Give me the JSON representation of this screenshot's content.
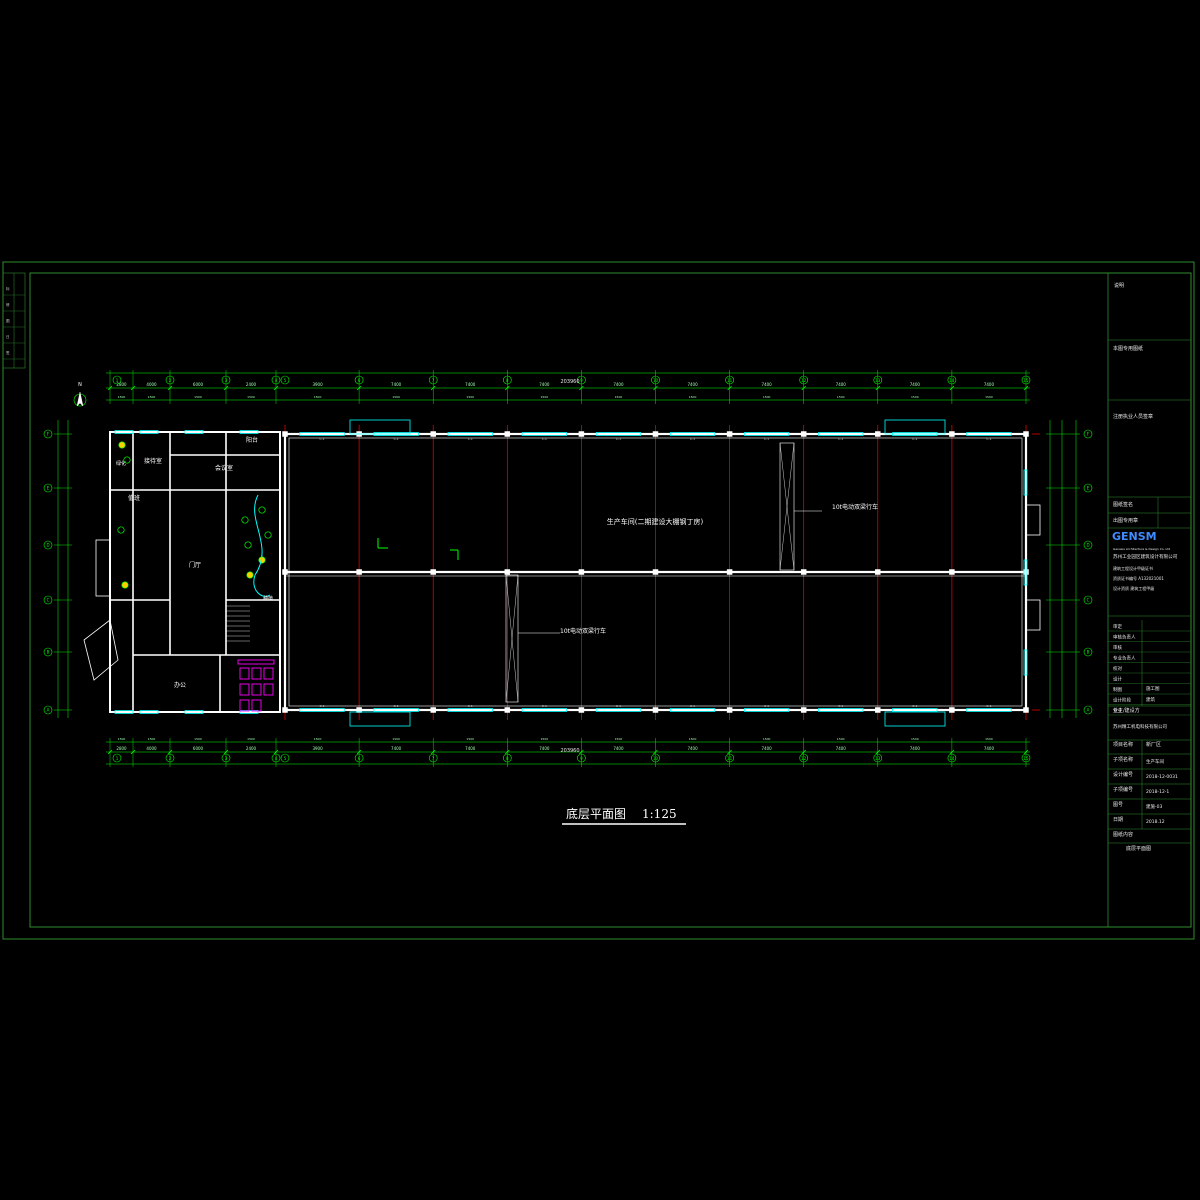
{
  "drawing": {
    "title": "底层平面图",
    "scale": "1:125",
    "colors": {
      "background": "#000000",
      "frame": "#2e8b2e",
      "dimension": "#00ff00",
      "wall": "#ffffff",
      "axis": "#ff0000",
      "window": "#00ffff",
      "label": "#ffff00",
      "sanitary": "#ff00ff",
      "planting": "#ffcc00"
    },
    "total_length": "203960",
    "rooms": {
      "workshop": "生产车间(二期建设大棚钢丁房)",
      "crane_upper": "10t电动双梁行车",
      "crane_lower": "10t电动双梁行车",
      "lobby": "门厅",
      "office": "办公",
      "meeting": "会议室",
      "reception": "接待室",
      "balcony": "阳台",
      "duty": "值班",
      "greening": "绿化",
      "planting": "种植"
    },
    "axes": {
      "top": [
        "1",
        "2",
        "3",
        "4",
        "5",
        "6",
        "7",
        "8",
        "9",
        "10",
        "11",
        "12",
        "13",
        "14",
        "15",
        "16"
      ],
      "left": [
        "A",
        "B",
        "C",
        "D",
        "E",
        "F"
      ]
    },
    "dimensions": {
      "top_bays": [
        "2800",
        "4000",
        "6000",
        "2400",
        "3900",
        "7400",
        "7400",
        "7400",
        "7400",
        "7400",
        "7400",
        "7400",
        "7400",
        "7400",
        "7000"
      ],
      "bottom_bays": [
        "2800",
        "4000",
        "6000",
        "2400",
        "3900",
        "7400",
        "7400",
        "7400",
        "7400",
        "7400",
        "7400",
        "7400",
        "7400",
        "7400",
        "7000"
      ]
    },
    "left_margin": [
      "标记",
      "修改",
      "图号",
      "日期",
      "签字"
    ]
  },
  "title_block": {
    "header": "说明",
    "notes": [
      "本图专用图纸",
      "注册执业人员签章"
    ],
    "sheet_label": "图纸签名",
    "sign_stamp": "出图专用章",
    "company_logo": "GENSM",
    "company_en": "Genesis Architecture & Design Co. Ltd",
    "company_cn": "苏州工业园区建筑设计有限公司",
    "licence_rows": [
      "建筑工程设计甲级证书",
      "资质证书编号 A132021001",
      "设计资质 建筑工程甲级"
    ],
    "roles": [
      "审定",
      "审核负责人",
      "审核",
      "专业负责人",
      "校对",
      "设计",
      "制图",
      "设计阶段",
      "专业"
    ],
    "role_values": {
      "stage": "施工图",
      "discipline": "建筑"
    },
    "client_label": "业主/建设方",
    "client_name": "苏州精工机电科技有限公司",
    "project_label": "项目名称",
    "project_name": "新厂区",
    "subitem_label": "子项名称",
    "subitem_name": "生产车间",
    "design_no_label": "设计编号",
    "design_no": "2018-12-0031",
    "subitem_no_label": "子项编号",
    "subitem_no": "2018-12-1",
    "drawing_no_label": "图号",
    "drawing_no": "建施-03",
    "date_label": "日期",
    "date": "2018.12",
    "drawing_name_label": "图纸内容",
    "drawing_name": "底层平面图"
  }
}
